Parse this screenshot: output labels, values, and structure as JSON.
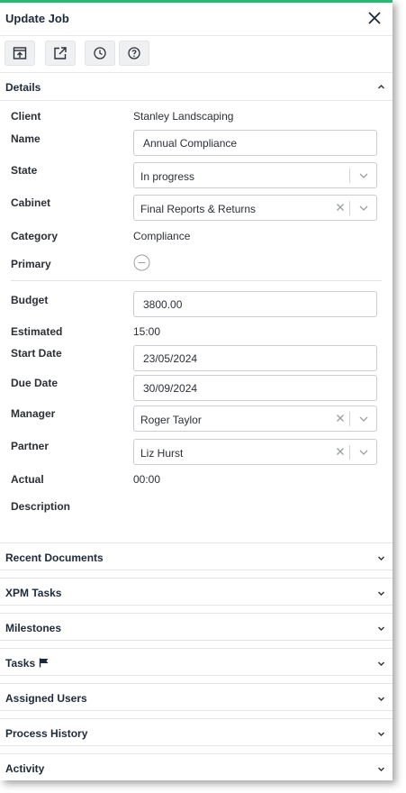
{
  "header": {
    "title": "Update Job",
    "close_icon": "close-icon"
  },
  "toolbar": {
    "buttons": [
      {
        "icon": "open-in-app-icon"
      },
      {
        "icon": "external-link-icon"
      },
      {
        "icon": "clock-icon"
      },
      {
        "icon": "help-icon"
      }
    ]
  },
  "details": {
    "heading": "Details",
    "fields": {
      "client_label": "Client",
      "client_value": "Stanley Landscaping",
      "name_label": "Name",
      "name_value": "Annual Compliance",
      "state_label": "State",
      "state_value": "In progress",
      "cabinet_label": "Cabinet",
      "cabinet_value": "Final Reports & Returns",
      "category_label": "Category",
      "category_value": "Compliance",
      "primary_label": "Primary",
      "budget_label": "Budget",
      "budget_value": "3800.00",
      "estimated_label": "Estimated",
      "estimated_value": "15:00",
      "start_date_label": "Start Date",
      "start_date_value": "23/05/2024",
      "due_date_label": "Due Date",
      "due_date_value": "30/09/2024",
      "manager_label": "Manager",
      "manager_value": "Roger Taylor",
      "partner_label": "Partner",
      "partner_value": "Liz Hurst",
      "actual_label": "Actual",
      "actual_value": "00:00",
      "description_label": "Description"
    }
  },
  "sections": [
    {
      "label": "Recent Documents"
    },
    {
      "label": "XPM Tasks"
    },
    {
      "label": "Milestones"
    },
    {
      "label": "Tasks",
      "icon": "flag-icon"
    },
    {
      "label": "Assigned Users"
    },
    {
      "label": "Process History"
    },
    {
      "label": "Activity"
    }
  ],
  "colors": {
    "accent": "#2bb673",
    "text": "#2b2f36",
    "border": "#c9ccd1"
  }
}
